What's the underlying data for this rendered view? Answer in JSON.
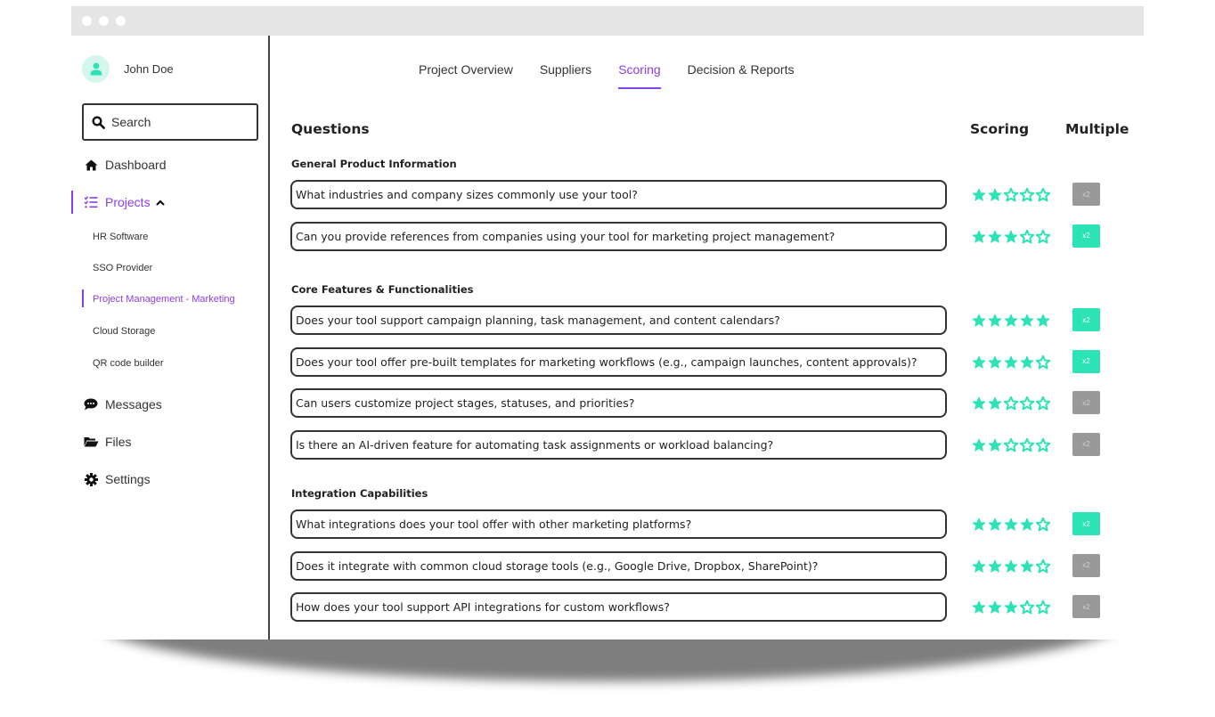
{
  "colors": {
    "accent": "#8b3df0",
    "star": "#2be3b5",
    "multiplier_on": "#2be3b5",
    "multiplier_off": "#999999",
    "avatar_bg": "#d4f6ec"
  },
  "user": {
    "name": "John Doe",
    "avatar_icon": "user-icon"
  },
  "search": {
    "label": "Search",
    "icon": "search-icon"
  },
  "sidebar": {
    "nav": [
      {
        "label": "Dashboard",
        "icon": "home-icon"
      },
      {
        "label": "Projects",
        "icon": "list-check-icon",
        "expanded": true
      },
      {
        "label": "Messages",
        "icon": "chat-bubble-icon"
      },
      {
        "label": "Files",
        "icon": "folder-open-icon"
      },
      {
        "label": "Settings",
        "icon": "gear-icon"
      }
    ],
    "projects": [
      {
        "label": "HR Software"
      },
      {
        "label": "SSO Provider"
      },
      {
        "label": "Project Management - Marketing",
        "active": true
      },
      {
        "label": "Cloud Storage"
      },
      {
        "label": "QR code builder"
      }
    ]
  },
  "tabs": [
    {
      "label": "Project Overview"
    },
    {
      "label": "Suppliers"
    },
    {
      "label": "Scoring",
      "active": true
    },
    {
      "label": "Decision & Reports"
    }
  ],
  "table": {
    "headers": {
      "questions": "Questions",
      "scoring": "Scoring",
      "multiple": "Multiple"
    },
    "max_stars": 5,
    "sections": [
      {
        "title": "General Product Information",
        "questions": [
          {
            "text": "What industries and company sizes commonly use your tool?",
            "score": 2,
            "multiplier": {
              "label": "x2",
              "active": false
            }
          },
          {
            "text": "Can you provide references from companies using your tool for marketing project management?",
            "score": 3,
            "multiplier": {
              "label": "x2",
              "active": true
            }
          }
        ]
      },
      {
        "title": "Core Features & Functionalities",
        "questions": [
          {
            "text": "Does your tool support campaign planning, task management, and content calendars?",
            "score": 5,
            "multiplier": {
              "label": "x2",
              "active": true
            }
          },
          {
            "text": "Does your tool offer pre-built templates for marketing workflows (e.g., campaign launches, content approvals)?",
            "score": 4,
            "multiplier": {
              "label": "x2",
              "active": true
            }
          },
          {
            "text": "Can users customize project stages, statuses, and priorities?",
            "score": 2,
            "multiplier": {
              "label": "x2",
              "active": false
            }
          },
          {
            "text": "Is there an AI-driven feature for automating task assignments or workload balancing?",
            "score": 2,
            "multiplier": {
              "label": "x2",
              "active": false
            }
          }
        ]
      },
      {
        "title": "Integration Capabilities",
        "questions": [
          {
            "text": "What integrations does your tool offer with other marketing platforms?",
            "score": 4,
            "multiplier": {
              "label": "x2",
              "active": true
            }
          },
          {
            "text": "Does it integrate with common cloud storage tools (e.g., Google Drive, Dropbox, SharePoint)?",
            "score": 4,
            "multiplier": {
              "label": "x2",
              "active": false
            }
          },
          {
            "text": "How does your tool support API integrations for custom workflows?",
            "score": 3,
            "multiplier": {
              "label": "x2",
              "active": false
            }
          }
        ]
      }
    ]
  }
}
